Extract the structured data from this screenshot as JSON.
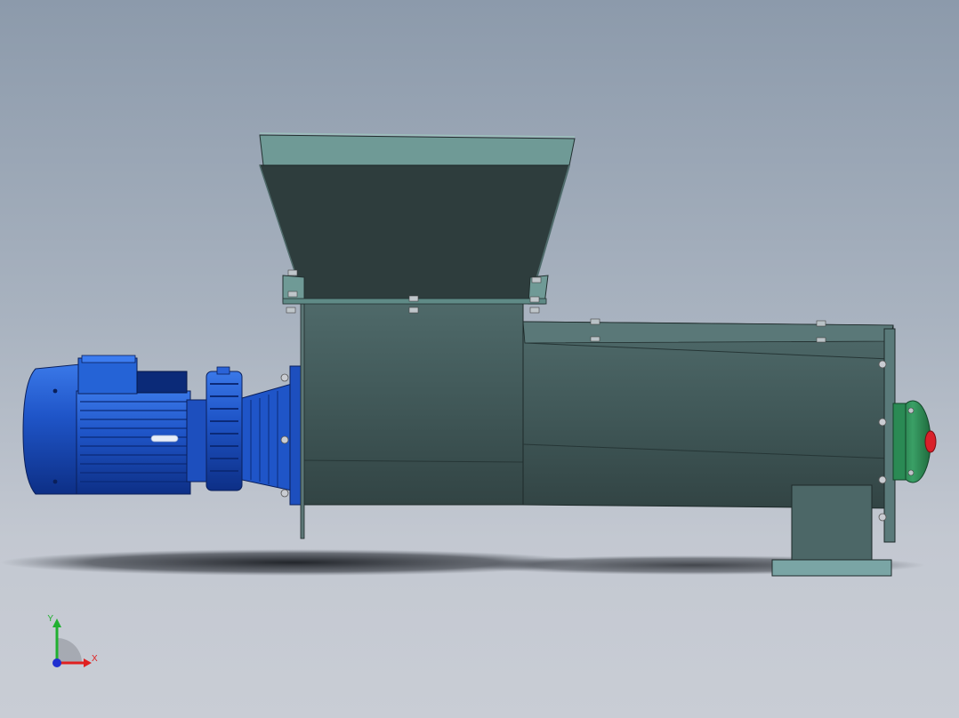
{
  "viewport": {
    "background_top": "#8c9aab",
    "background_bottom": "#c9cdd5"
  },
  "model": {
    "motor_color": "#1f55c8",
    "housing_color": "#3f5656",
    "hopper_color": "#2e3d3d",
    "hopper_rim_color": "#6f9a96",
    "flange_color": "#2f8a55",
    "cap_color": "#d9202a"
  },
  "triad": {
    "x_label": "X",
    "y_label": "Y",
    "x_color": "#e02020",
    "y_color": "#20b030",
    "z_color": "#2030d0",
    "icons": [
      "axis-triad-icon"
    ]
  }
}
